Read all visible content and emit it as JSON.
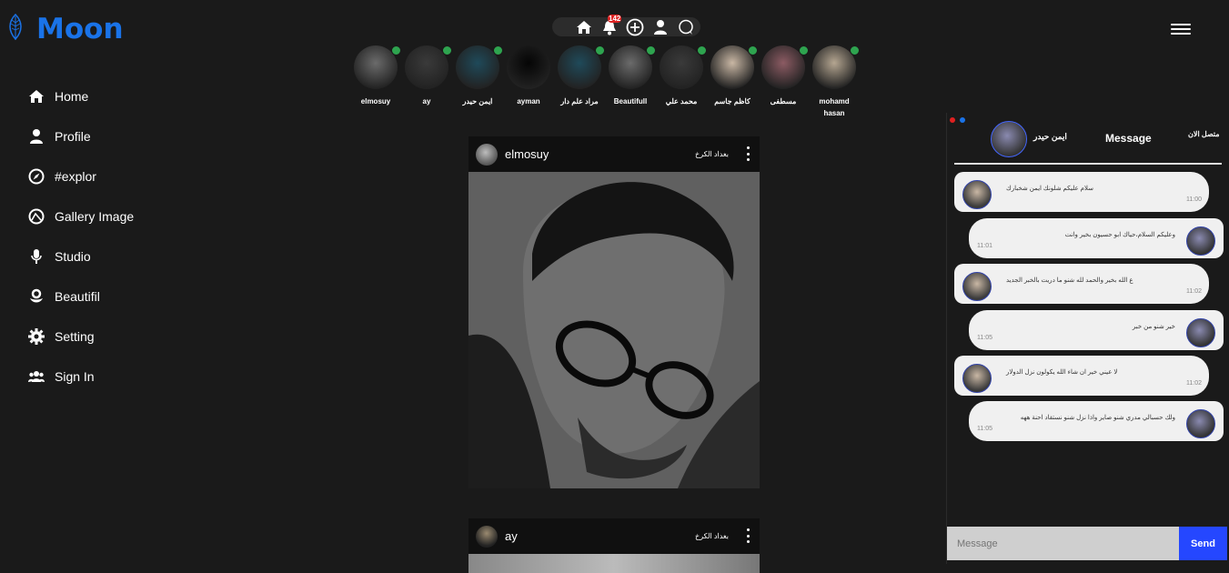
{
  "brand": {
    "name": "Moon"
  },
  "nav": {
    "items": [
      {
        "label": "Home",
        "icon": "home-icon"
      },
      {
        "label": "Profile",
        "icon": "user-icon"
      },
      {
        "label": "#explor",
        "icon": "compass-icon"
      },
      {
        "label": "Gallery Image",
        "icon": "gallery-icon"
      },
      {
        "label": "Studio",
        "icon": "mic-icon"
      },
      {
        "label": "Beautifil",
        "icon": "flower-icon"
      },
      {
        "label": "Setting",
        "icon": "gear-icon"
      },
      {
        "label": "Sign In",
        "icon": "group-icon"
      }
    ]
  },
  "topnav": {
    "notification_count": "142"
  },
  "stories": [
    {
      "name": "elmosuy",
      "online": true,
      "color": "#6b6b6b"
    },
    {
      "name": "ay",
      "online": true,
      "color": "#3a3a3a"
    },
    {
      "name": "ايمن حيدر",
      "online": true,
      "color": "#1f4a5a"
    },
    {
      "name": "ayman",
      "online": false,
      "color": "#050505"
    },
    {
      "name": "مراد علم دار",
      "online": true,
      "color": "#1f4a5a"
    },
    {
      "name": "Beautifull",
      "online": true,
      "color": "#6b6b6b"
    },
    {
      "name": "محمد علي",
      "online": true,
      "color": "#3a3a3a"
    },
    {
      "name": "كاظم جاسم",
      "online": true,
      "color": "#c9b7a4"
    },
    {
      "name": "مسطفى",
      "online": true,
      "color": "#8c5b63"
    },
    {
      "name": "mohamd hasan",
      "online": true,
      "color": "#b5a691"
    }
  ],
  "posts": [
    {
      "user": "elmosuy",
      "location": "بغداد الكرخ"
    },
    {
      "user": "ay",
      "location": "بغداد الكرخ"
    }
  ],
  "chat": {
    "contact_name": "ايمن حيدر",
    "title": "Message",
    "status": "متصل الان",
    "messages": [
      {
        "side": "left",
        "text": "سلام عليكم شلونك ايمن شخبارك",
        "time": "11:00"
      },
      {
        "side": "right",
        "text": "وعليكم السلام،حياك ابو حسيون بخير وانت",
        "time": "11:01"
      },
      {
        "side": "left",
        "text": "ع الله بخير والحمد لله شنو ما دريت بالخبر الجديد",
        "time": "11:02"
      },
      {
        "side": "right",
        "text": "خير شنو من خبر",
        "time": "11:05"
      },
      {
        "side": "left",
        "text": "لا عيني خير ان شاء الله يكولون نزل الدولار",
        "time": "11:02"
      },
      {
        "side": "right",
        "text": "ولك حسبالي مدري شنو صاير واذا نزل شنو نستفاد احنة ههه",
        "time": "11:05"
      }
    ],
    "input_placeholder": "Message",
    "send_label": "Send"
  },
  "colors": {
    "brand": "#1a73e8",
    "online": "#2ea44f",
    "send": "#2547ff",
    "win_red": "#e02020",
    "win_blue": "#1a73e8"
  }
}
